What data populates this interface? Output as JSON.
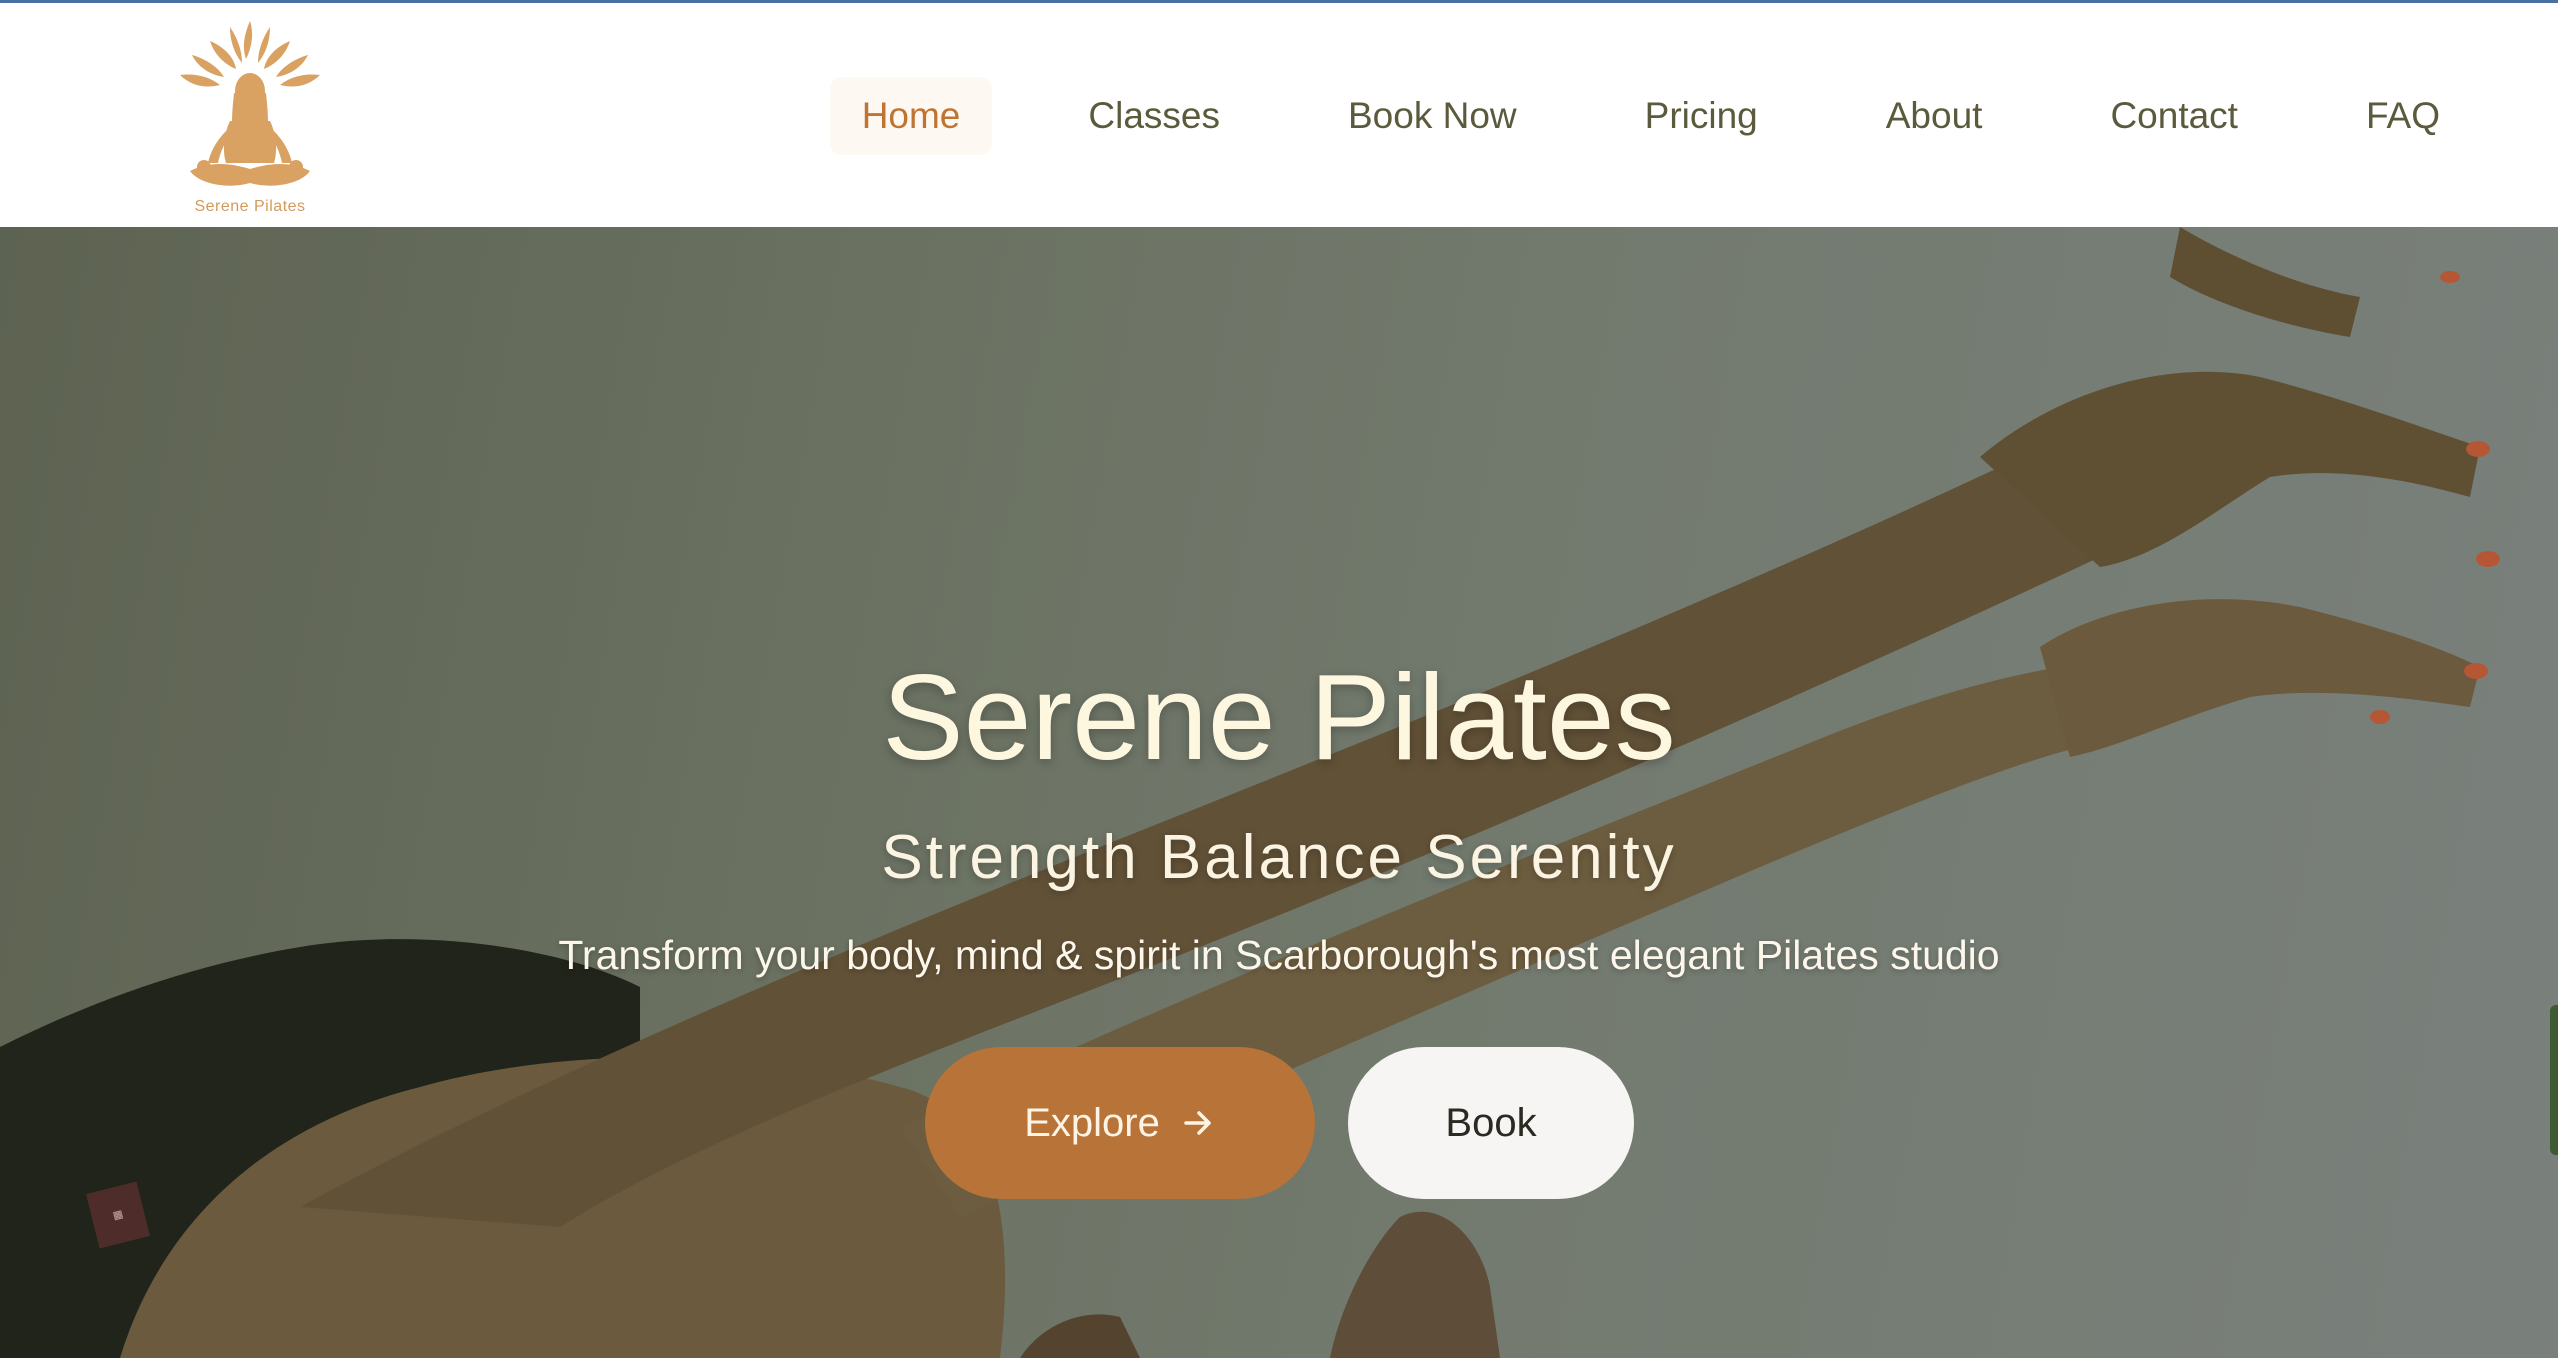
{
  "brand": {
    "name": "Serene Pilates",
    "logo_icon": "meditating-figure-sun-icon",
    "logo_color": "#d49a5c"
  },
  "nav": {
    "items": [
      {
        "label": "Home",
        "active": true
      },
      {
        "label": "Classes",
        "active": false
      },
      {
        "label": "Book Now",
        "active": false
      },
      {
        "label": "Pricing",
        "active": false
      },
      {
        "label": "About",
        "active": false
      },
      {
        "label": "Contact",
        "active": false
      },
      {
        "label": "FAQ",
        "active": false
      }
    ],
    "text_color": "#5c5a3c",
    "active_color": "#c07432"
  },
  "hero": {
    "title": "Serene Pilates",
    "subtitle": "Strength Balance Serenity",
    "tagline": "Transform your body, mind & spirit in Scarborough's most elegant Pilates studio",
    "explore_button": {
      "label": "Explore",
      "icon": "arrow-right-icon",
      "color": "#b87338"
    },
    "book_button": {
      "label": "Book"
    }
  }
}
